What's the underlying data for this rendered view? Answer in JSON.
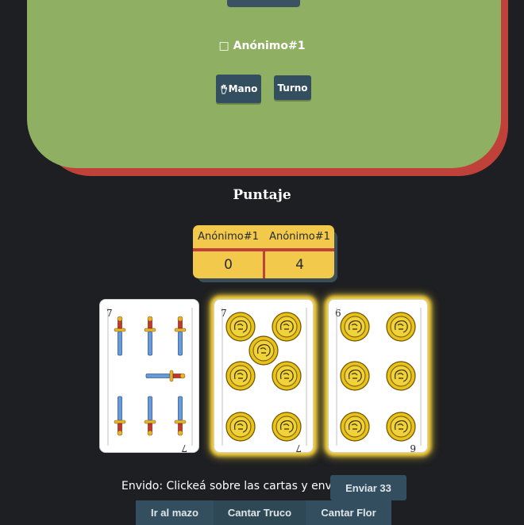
{
  "opponent": {
    "name": "Anónimo#1",
    "status_icon": "□"
  },
  "badges": {
    "mano_label": "Mano",
    "turno_label": "Turno"
  },
  "score": {
    "title": "Puntaje",
    "headers": [
      "Anónimo#1",
      "Anónimo#1"
    ],
    "values": [
      "0",
      "4"
    ]
  },
  "cards": [
    {
      "rank": "7",
      "suit": "espadas",
      "selected": false
    },
    {
      "rank": "7",
      "suit": "oros",
      "selected": true
    },
    {
      "rank": "6",
      "suit": "oros",
      "selected": true
    }
  ],
  "envido": {
    "prompt": "Envido: Clickeá sobre las cartas y enviá",
    "send_label": "Enviar 33"
  },
  "actions": {
    "mazo_label": "Ir al mazo",
    "truco_label": "Cantar Truco",
    "flor_label": "Cantar Flor"
  },
  "colors": {
    "table_felt": "#8fb062",
    "table_rim": "#c0413a",
    "score_bg": "#f2c94a",
    "button_bg": "#334e5e",
    "background": "#1e1f22"
  }
}
